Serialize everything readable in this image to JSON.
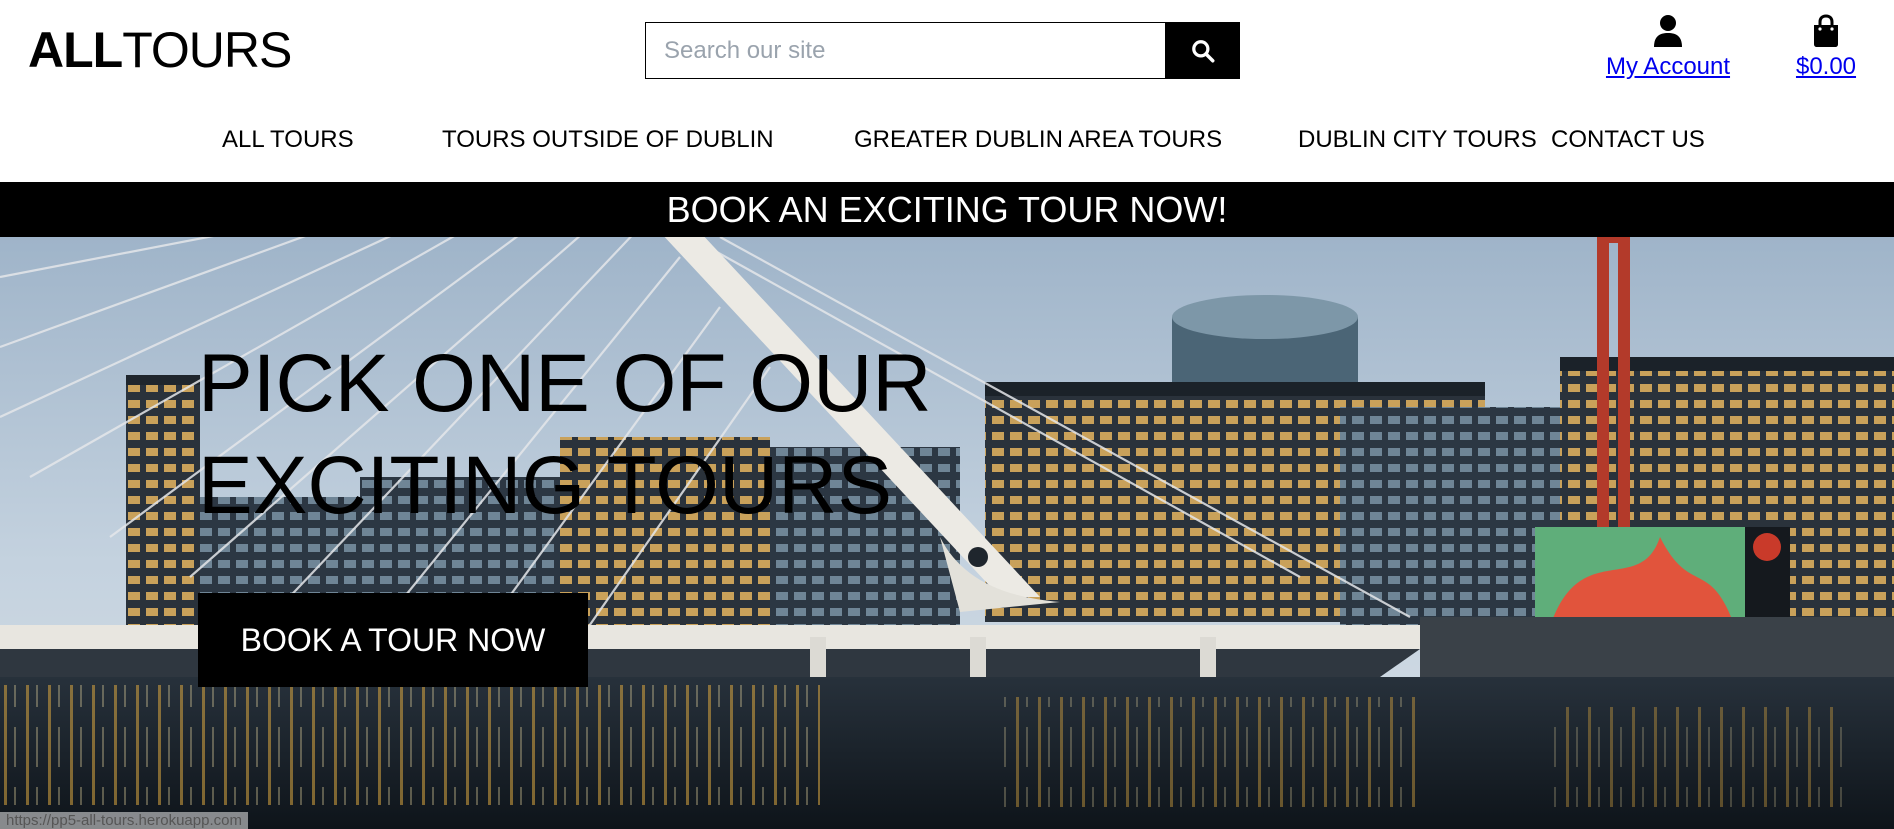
{
  "header": {
    "logo_strong": "ALL",
    "logo_light": "TOURS",
    "search_placeholder": "Search our site",
    "account_label": "My Account",
    "cart_total": "$0.00"
  },
  "nav": {
    "items": [
      "ALL TOURS",
      "TOURS OUTSIDE OF DUBLIN",
      "GREATER DUBLIN AREA TOURS",
      "DUBLIN CITY TOURS",
      "CONTACT US"
    ]
  },
  "banner": {
    "text": "BOOK AN EXCITING TOUR NOW!"
  },
  "hero": {
    "title_line1": "PICK ONE OF OUR",
    "title_line2": "EXCITING TOURS",
    "button_label": "BOOK A TOUR NOW"
  },
  "status_bar": {
    "url": "https://pp5-all-tours.herokuapp.com"
  },
  "icons": {
    "search": "search-icon",
    "account": "user-icon",
    "cart": "shopping-bag-icon"
  },
  "colors": {
    "primary": "#000000",
    "background": "#ffffff",
    "banner_text": "#ffffff",
    "placeholder": "#9aa3ad"
  }
}
